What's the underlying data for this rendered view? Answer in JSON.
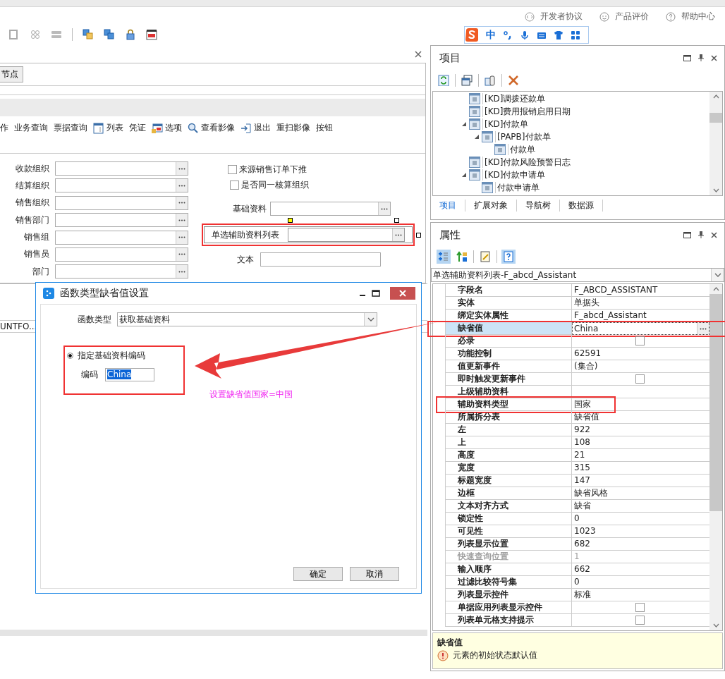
{
  "header_links": [
    {
      "label": "开发者协议"
    },
    {
      "label": "产品评价"
    },
    {
      "label": "帮助中心"
    }
  ],
  "ime_bar": {
    "mode": "中"
  },
  "designer": {
    "parent_button": "节点",
    "toolbar": [
      {
        "label": "作"
      },
      {
        "label": "业务查询"
      },
      {
        "label": "票据查询"
      },
      {
        "label": "列表"
      },
      {
        "label": "凭证"
      },
      {
        "label": "选项"
      },
      {
        "label": "查看影像"
      },
      {
        "label": "退出"
      },
      {
        "label": "重扫影像"
      },
      {
        "label": "按钮"
      }
    ],
    "left_fields": [
      {
        "label": "收款组织"
      },
      {
        "label": "结算组织"
      },
      {
        "label": "销售组织"
      },
      {
        "label": "销售部门"
      },
      {
        "label": "销售组"
      },
      {
        "label": "销售员"
      },
      {
        "label": "部门"
      }
    ],
    "checkboxes": [
      {
        "label": "来源销售订单下推",
        "checked": false
      },
      {
        "label": "是否同一核算组织",
        "checked": false
      }
    ],
    "right_fields": [
      {
        "label": "基础资料",
        "kind": "lookup",
        "selected": false
      },
      {
        "label": "单选辅助资料列表",
        "kind": "lookup",
        "selected": true
      },
      {
        "label": "文本",
        "kind": "text",
        "selected": false
      }
    ],
    "grid_header": "UNTFO..."
  },
  "dialog": {
    "title": "函数类型缺省值设置",
    "function_type_label": "函数类型",
    "function_type_value": "获取基础资料",
    "options": [
      {
        "label": "指定基础资料编码",
        "selected": true
      }
    ],
    "code_label": "编码",
    "code_value": "China",
    "buttons": [
      "确定",
      "取消"
    ]
  },
  "annotation": {
    "note": "设置缺省值国家=中国"
  },
  "project_panel": {
    "title": "项目",
    "tree": [
      {
        "label": "[KD]调拨还款单"
      },
      {
        "label": "[KD]费用报销启用日期"
      },
      {
        "label": "[KD]付款单",
        "expanded": true,
        "children": [
          {
            "label": "[PAPB]付款单",
            "expanded": true,
            "children": [
              {
                "label": "付款单"
              }
            ]
          }
        ]
      },
      {
        "label": "[KD]付款风险预警日志"
      },
      {
        "label": "[KD]付款申请单",
        "expanded": true,
        "children": [
          {
            "label": "付款申请单"
          }
        ]
      }
    ],
    "tabs": [
      {
        "label": "项目",
        "selected": true
      },
      {
        "label": "扩展对象",
        "selected": false
      },
      {
        "label": "导航树",
        "selected": false
      },
      {
        "label": "数据源",
        "selected": false
      }
    ]
  },
  "property_panel": {
    "title": "属性",
    "toolbar": [
      {
        "pressed": true
      },
      {
        "pressed": false
      },
      {
        "pressed": false
      },
      {
        "pressed": true
      }
    ],
    "object_selector": "单选辅助资料列表-F_abcd_Assistant",
    "properties": [
      {
        "name": "字段名",
        "kind": "text",
        "value": "F_ABCD_ASSISTANT",
        "selected": false,
        "disabled": false
      },
      {
        "name": "实体",
        "kind": "text",
        "value": "单据头",
        "selected": false,
        "disabled": false
      },
      {
        "name": "绑定实体属性",
        "kind": "text",
        "value": "F_abcd_Assistant",
        "selected": false,
        "disabled": false
      },
      {
        "name": "缺省值",
        "kind": "lookup",
        "value": "China",
        "selected": true,
        "disabled": false
      },
      {
        "name": "必录",
        "kind": "checkbox",
        "checked": false,
        "selected": false,
        "disabled": false
      },
      {
        "name": "功能控制",
        "kind": "text",
        "value": "62591",
        "selected": false,
        "disabled": false
      },
      {
        "name": "值更新事件",
        "kind": "text",
        "value": "(集合)",
        "selected": false,
        "disabled": false
      },
      {
        "name": "即时触发更新事件",
        "kind": "checkbox",
        "checked": false,
        "selected": false,
        "disabled": false
      },
      {
        "name": "上级辅助资料",
        "kind": "text",
        "selected": false,
        "disabled": false
      },
      {
        "name": "辅助资料类型",
        "kind": "text",
        "value": "国家",
        "selected": false,
        "disabled": false
      },
      {
        "name": "所属拆分表",
        "kind": "text",
        "value": "缺省值",
        "selected": false,
        "disabled": false
      },
      {
        "name": "左",
        "kind": "text",
        "value": "922",
        "selected": false,
        "disabled": false
      },
      {
        "name": "上",
        "kind": "text",
        "value": "108",
        "selected": false,
        "disabled": false
      },
      {
        "name": "高度",
        "kind": "text",
        "value": "21",
        "selected": false,
        "disabled": false
      },
      {
        "name": "宽度",
        "kind": "text",
        "value": "315",
        "selected": false,
        "disabled": false
      },
      {
        "name": "标题宽度",
        "kind": "text",
        "value": "147",
        "selected": false,
        "disabled": false
      },
      {
        "name": "边框",
        "kind": "text",
        "value": "缺省风格",
        "selected": false,
        "disabled": false
      },
      {
        "name": "文本对齐方式",
        "kind": "text",
        "value": "缺省",
        "selected": false,
        "disabled": false
      },
      {
        "name": "锁定性",
        "kind": "text",
        "value": "0",
        "selected": false,
        "disabled": false
      },
      {
        "name": "可见性",
        "kind": "text",
        "value": "1023",
        "selected": false,
        "disabled": false
      },
      {
        "name": "列表显示位置",
        "kind": "text",
        "value": "682",
        "selected": false,
        "disabled": false
      },
      {
        "name": "快速查询位置",
        "kind": "text",
        "value": "1",
        "selected": false,
        "disabled": true
      },
      {
        "name": "输入顺序",
        "kind": "text",
        "value": "662",
        "selected": false,
        "disabled": false
      },
      {
        "name": "过滤比较符号集",
        "kind": "text",
        "value": "0",
        "selected": false,
        "disabled": false
      },
      {
        "name": "列表显示控件",
        "kind": "text",
        "value": "标准",
        "selected": false,
        "disabled": false
      },
      {
        "name": "单据应用列表显示控件",
        "kind": "checkbox",
        "checked": false,
        "selected": false,
        "disabled": false
      },
      {
        "name": "列表单元格支持提示",
        "kind": "checkbox",
        "checked": false,
        "selected": false,
        "disabled": false
      }
    ],
    "description": {
      "title": "缺省值",
      "text": "元素的初始状态默认值"
    }
  }
}
